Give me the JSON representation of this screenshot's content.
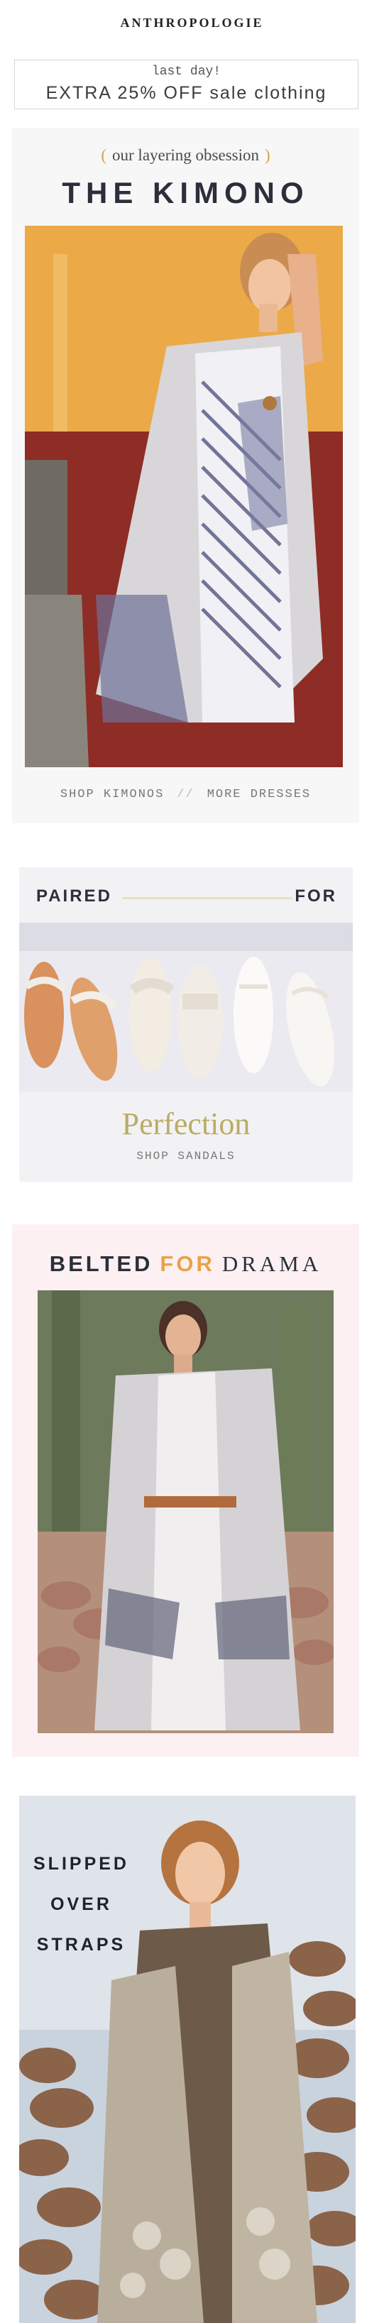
{
  "header": {
    "brand": "ANTHROPOLOGIE"
  },
  "promo": {
    "eyebrow": "last day!",
    "offer": "EXTRA 25% OFF sale clothing"
  },
  "kimono": {
    "tagline": "our layering obsession",
    "paren_open": "(",
    "paren_close": ")",
    "title": "THE KIMONO",
    "link_kimonos": "SHOP KIMONOS",
    "link_sep": "//",
    "link_dresses": "MORE DRESSES"
  },
  "sandals": {
    "paired": "PAIRED",
    "for": "FOR",
    "perfection": "Perfection",
    "shop": "SHOP SANDALS"
  },
  "belted": {
    "w1": "BELTED",
    "w2": "FOR",
    "w3": "DRAMA"
  },
  "straps": {
    "line1": "SLIPPED",
    "line2": "OVER",
    "line3": "STRAPS"
  },
  "colors": {
    "gold": "#d7a048",
    "navy_text": "#2b2f3a",
    "perfection_olive": "#b9ac65",
    "belted_pink_bg": "#fcf0f2"
  }
}
